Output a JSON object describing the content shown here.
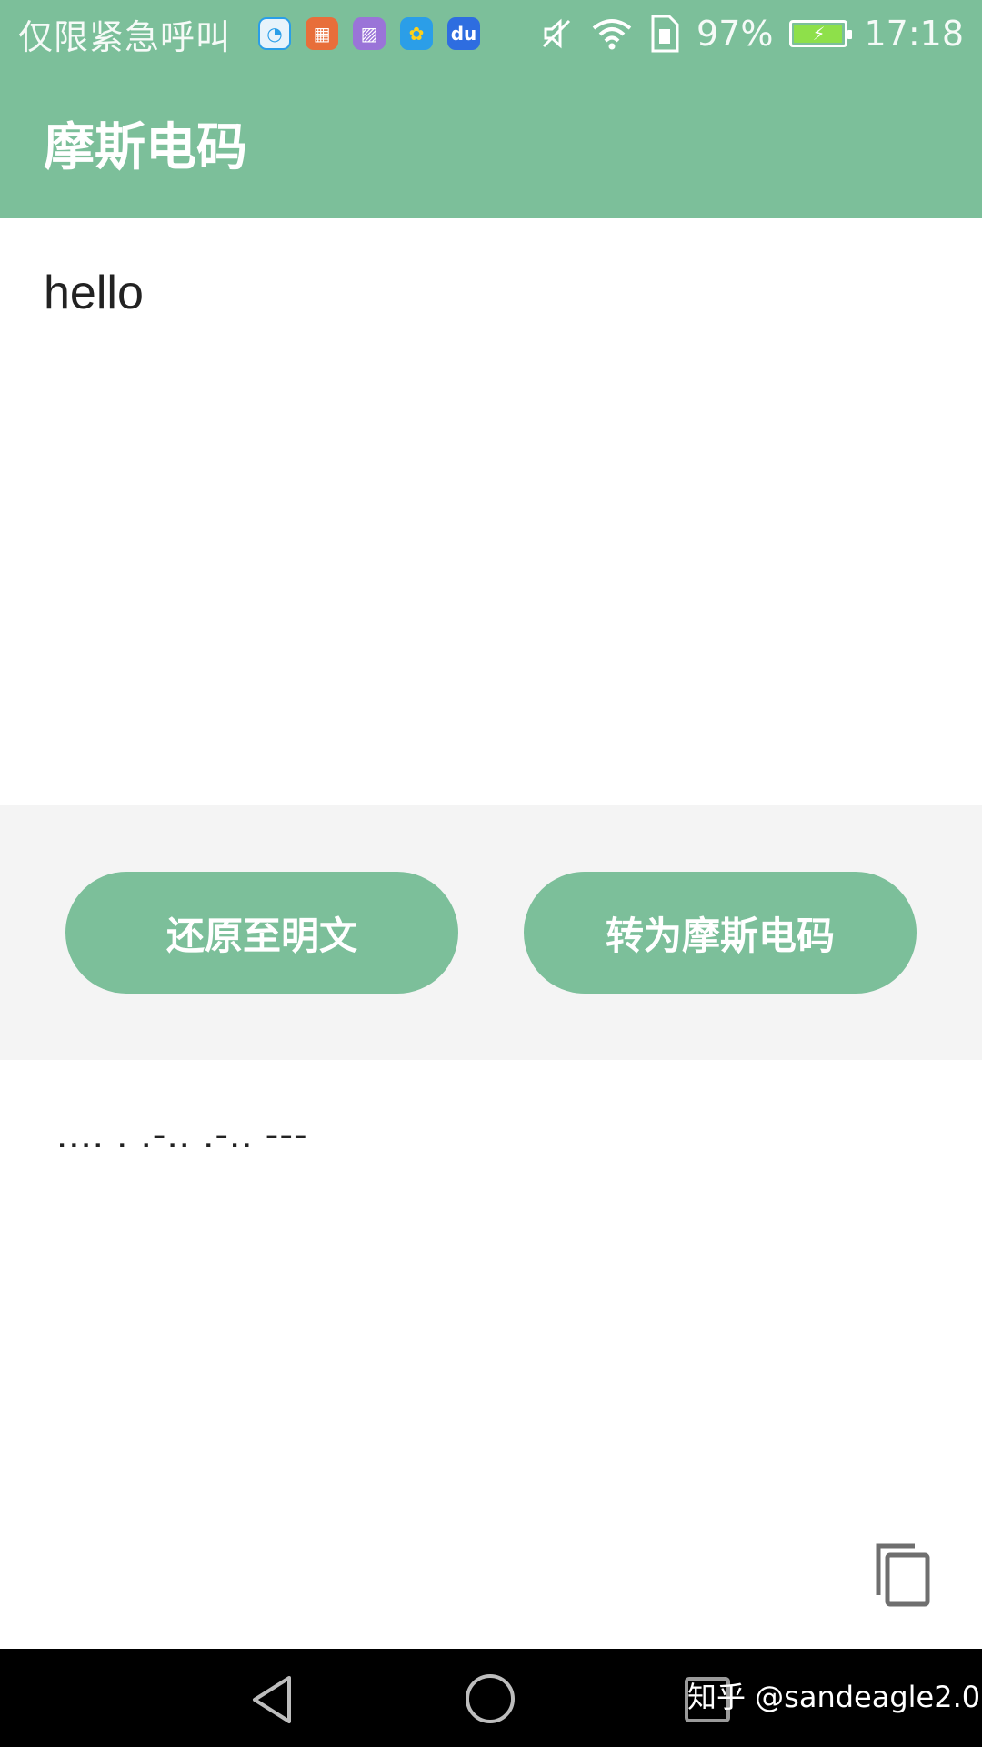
{
  "status_bar": {
    "carrier_text": "仅限紧急呼叫",
    "app_icons": [
      "browser-icon",
      "calendar-app-icon",
      "gallery-icon",
      "bird-app-icon",
      "baidu-icon"
    ],
    "baidu_icon_text": "du",
    "battery_percent": "97%",
    "battery_level": 0.97,
    "time": "17:18"
  },
  "app_bar": {
    "title": "摩斯电码"
  },
  "input": {
    "value": "hello"
  },
  "buttons": {
    "restore_label": "还原至明文",
    "convert_label": "转为摩斯电码"
  },
  "output": {
    "text": ".... . .-.. .-.. ---"
  },
  "watermark": {
    "text": "知乎 @sandeagle2.0"
  },
  "colors": {
    "primary": "#7cbf9a",
    "band_background": "#f4f4f4",
    "nav_background": "#000000"
  }
}
